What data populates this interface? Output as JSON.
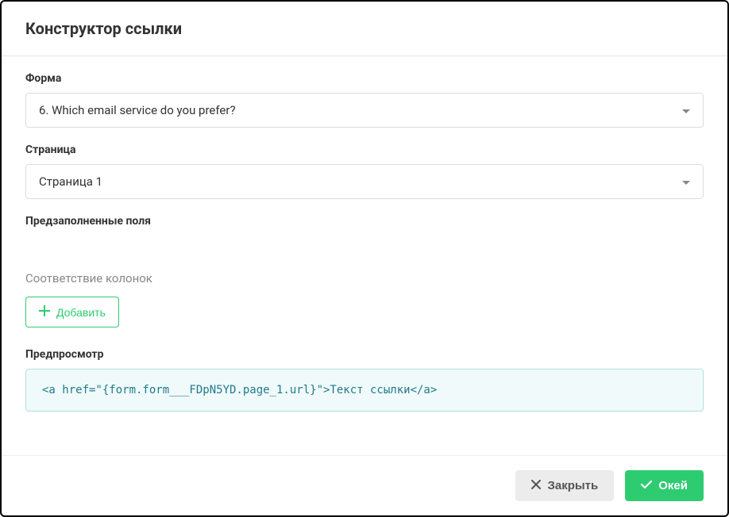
{
  "header": {
    "title": "Конструктор ссылки"
  },
  "form": {
    "label": "Форма",
    "selected": "6. Which email service do you prefer?"
  },
  "page": {
    "label": "Страница",
    "selected": "Страница 1"
  },
  "prefilled": {
    "label": "Предзаполненные поля"
  },
  "columns": {
    "label": "Соответствие колонок",
    "add_label": "Добавить"
  },
  "preview": {
    "label": "Предпросмотр",
    "value": "<a href=\"{form.form___FDpN5YD.page_1.url}\">Текст ссылки</a>"
  },
  "footer": {
    "close_label": "Закрыть",
    "ok_label": "Окей"
  }
}
